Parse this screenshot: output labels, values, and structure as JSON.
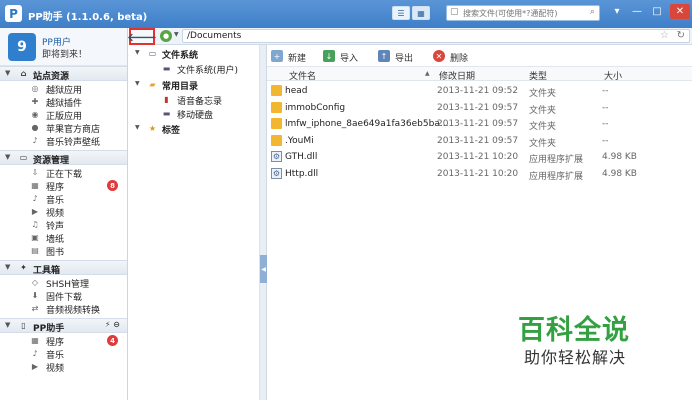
{
  "titlebar": {
    "app_logo": "P",
    "title": "PP助手 (1.1.0.6, beta)",
    "search_placeholder": "搜索文件(可使用*?通配符)",
    "view_list_icon": "list-view-icon",
    "view_grid_icon": "grid-view-icon"
  },
  "user": {
    "avatar": "9",
    "name": "PP用户",
    "welcome": "即将到来！"
  },
  "sidebar": {
    "sections": [
      {
        "label": "站点资源",
        "icon": "home-icon",
        "items": [
          {
            "label": "越狱应用",
            "icon": "app-icon"
          },
          {
            "label": "越狱插件",
            "icon": "plugin-icon"
          },
          {
            "label": "正版应用",
            "icon": "store-icon"
          },
          {
            "label": "苹果官方商店",
            "icon": "apple-icon"
          },
          {
            "label": "音乐铃声壁纸",
            "icon": "music-icon"
          }
        ]
      },
      {
        "label": "资源管理",
        "icon": "monitor-icon",
        "items": [
          {
            "label": "正在下载",
            "icon": "download-icon"
          },
          {
            "label": "程序",
            "icon": "program-icon",
            "badge": "8"
          },
          {
            "label": "音乐",
            "icon": "music-icon"
          },
          {
            "label": "视频",
            "icon": "video-icon"
          },
          {
            "label": "铃声",
            "icon": "ringtone-icon"
          },
          {
            "label": "墙纸",
            "icon": "wallpaper-icon"
          },
          {
            "label": "图书",
            "icon": "book-icon"
          }
        ]
      },
      {
        "label": "工具箱",
        "icon": "tools-icon",
        "items": [
          {
            "label": "SHSH管理",
            "icon": "shsh-icon"
          },
          {
            "label": "固件下载",
            "icon": "firmware-icon"
          },
          {
            "label": "音频视频转换",
            "icon": "convert-icon"
          }
        ]
      },
      {
        "label": "PP助手",
        "icon": "phone-icon",
        "items": [
          {
            "label": "程序",
            "icon": "program-icon",
            "badge": "4"
          },
          {
            "label": "音乐",
            "icon": "music-icon"
          },
          {
            "label": "视频",
            "icon": "video-icon"
          }
        ]
      }
    ]
  },
  "nav": {
    "path": "/Documents"
  },
  "tree": [
    {
      "label": "文件系统",
      "icon": "computer-icon",
      "level": 0,
      "bold": true
    },
    {
      "label": "文件系统(用户)",
      "icon": "drive-icon",
      "level": 1,
      "bold": false
    },
    {
      "label": "常用目录",
      "icon": "folder-icon",
      "level": 0,
      "bold": true
    },
    {
      "label": "语音备忘录",
      "icon": "voice-memo-icon",
      "level": 1,
      "bold": false
    },
    {
      "label": "移动硬盘",
      "icon": "disk-icon",
      "level": 1,
      "bold": false
    },
    {
      "label": "标签",
      "icon": "bookmark-icon",
      "level": 0,
      "bold": true
    }
  ],
  "toolbar": {
    "new": "新建",
    "import": "导入",
    "export": "导出",
    "delete": "删除"
  },
  "columns": {
    "name": "文件名",
    "date": "修改日期",
    "type": "类型",
    "size": "大小"
  },
  "files": [
    {
      "name": "head",
      "date": "2013-11-21 09:52",
      "type": "文件夹",
      "size": "--",
      "kind": "folder"
    },
    {
      "name": "immobConfig",
      "date": "2013-11-21 09:57",
      "type": "文件夹",
      "size": "--",
      "kind": "folder"
    },
    {
      "name": "lmfw_iphone_8ae649a1fa36eb5ba...",
      "date": "2013-11-21 09:57",
      "type": "文件夹",
      "size": "--",
      "kind": "folder"
    },
    {
      "name": ".YouMi",
      "date": "2013-11-21 09:57",
      "type": "文件夹",
      "size": "--",
      "kind": "folder"
    },
    {
      "name": "GTH.dll",
      "date": "2013-11-21 10:20",
      "type": "应用程序扩展",
      "size": "4.98 KB",
      "kind": "dll"
    },
    {
      "name": "Http.dll",
      "date": "2013-11-21 10:20",
      "type": "应用程序扩展",
      "size": "4.98 KB",
      "kind": "dll"
    }
  ],
  "watermark": {
    "title": "百科全说",
    "subtitle": "助你轻松解决"
  },
  "colors": {
    "titlebar": "#4a8ad0",
    "highlight_border": "#e53030",
    "badge": "#e03b3b",
    "watermark": "#33a142"
  }
}
